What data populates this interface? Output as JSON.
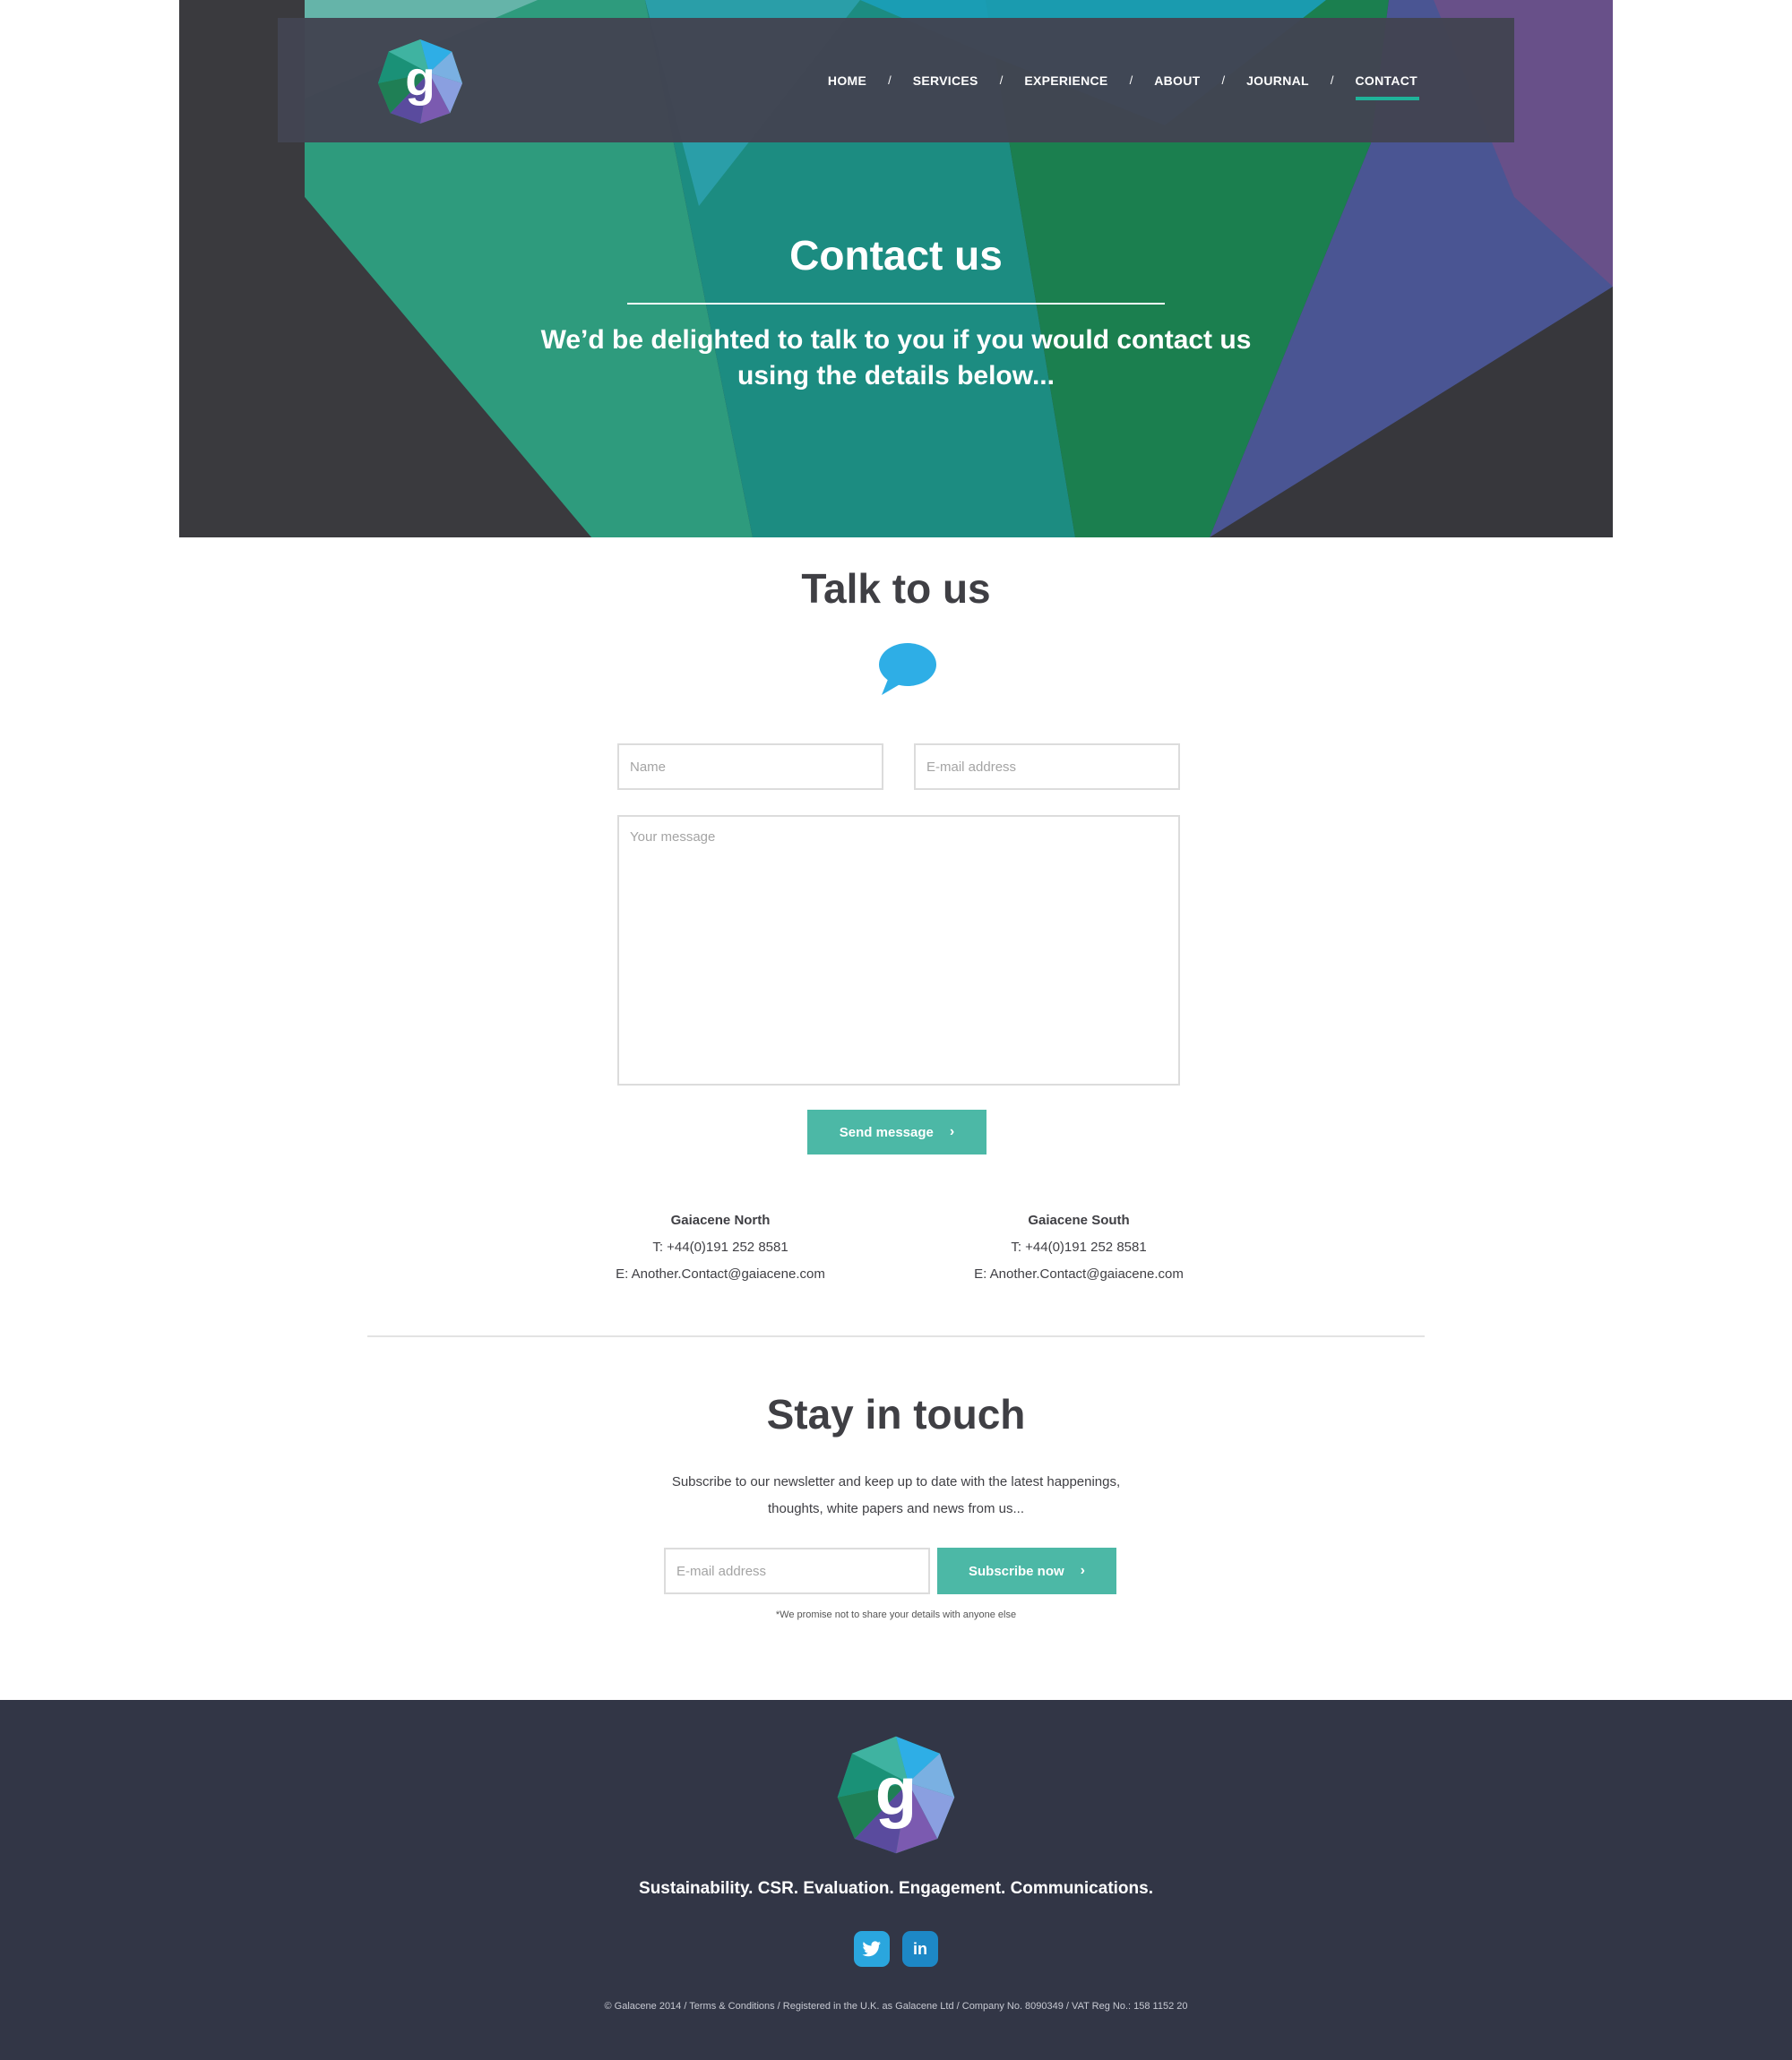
{
  "nav": {
    "items": [
      {
        "label": "HOME"
      },
      {
        "label": "SERVICES"
      },
      {
        "label": "EXPERIENCE"
      },
      {
        "label": "ABOUT"
      },
      {
        "label": "JOURNAL"
      },
      {
        "label": "CONTACT",
        "active": true
      }
    ],
    "separator": "/"
  },
  "logo": {
    "letter": "g"
  },
  "hero": {
    "title": "Contact us",
    "subtitle": "We’d be delighted to talk to you if you would contact us using the details below..."
  },
  "talk": {
    "title": "Talk to us",
    "icon": "speech-bubble-icon",
    "form": {
      "name_placeholder": "Name",
      "email_placeholder": "E-mail address",
      "message_placeholder": "Your message",
      "send_label": "Send message"
    }
  },
  "offices": [
    {
      "name": "Gaiacene North",
      "phone": "T: +44(0)191 252 8581",
      "email": "E: Another.Contact@gaiacene.com"
    },
    {
      "name": "Gaiacene South",
      "phone": "T: +44(0)191 252 8581",
      "email": "E: Another.Contact@gaiacene.com"
    }
  ],
  "newsletter": {
    "title": "Stay in touch",
    "text": "Subscribe to our newsletter and keep up to date with the latest happenings, thoughts, white papers and news from us...",
    "email_placeholder": "E-mail address",
    "subscribe_label": "Subscribe now",
    "promise": "*We promise not to share your details with anyone else"
  },
  "footer": {
    "tagline": "Sustainability. CSR. Evaluation. Engagement. Communications.",
    "social": [
      "twitter-icon",
      "linkedin-icon"
    ],
    "linkedin_text": "in",
    "copyright": "© Galacene 2014   /  Terms & Conditions /  Registered in the U.K. as Galacene Ltd  /  Company No. 8090349 / VAT Reg No.: 158 1152 20"
  },
  "colors": {
    "accent": "#4cb8a6",
    "nav_active": "#1fb39a",
    "footer_bg": "#323646",
    "bubble": "#2eaee6"
  }
}
